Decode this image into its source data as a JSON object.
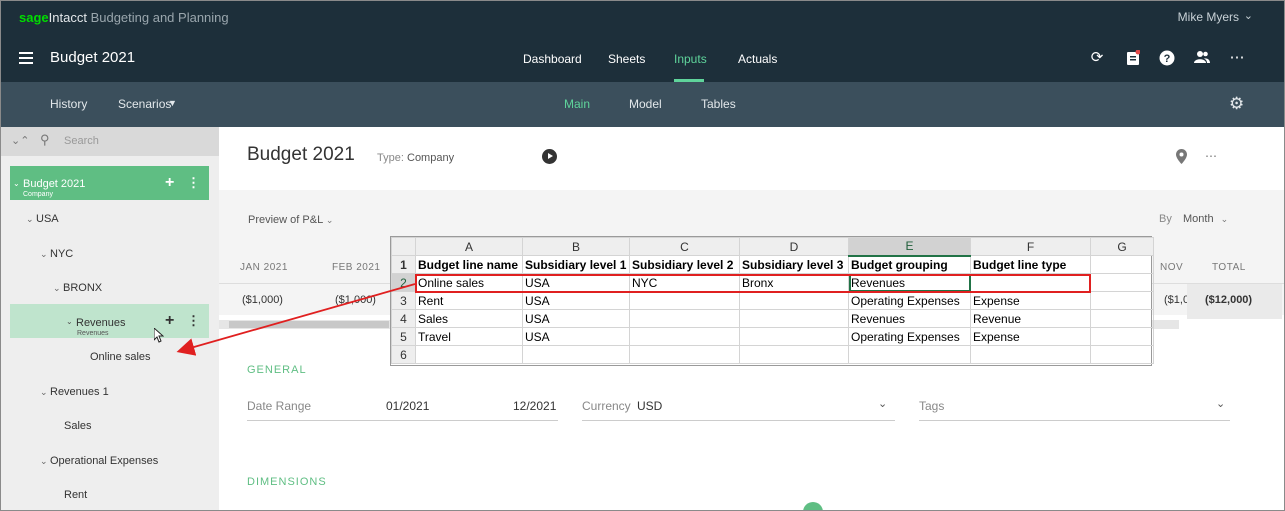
{
  "app": {
    "brand_sage": "sage",
    "brand_intacct": "Intacct",
    "brand_product": "Budgeting and Planning",
    "user_name": "Mike Myers",
    "title": "Budget 2021"
  },
  "main_nav": [
    "Dashboard",
    "Sheets",
    "Inputs",
    "Actuals"
  ],
  "main_nav_active": "Inputs",
  "sub_nav": {
    "left": [
      "History",
      "Scenarios"
    ],
    "center": [
      "Main",
      "Model",
      "Tables"
    ],
    "active": "Main"
  },
  "sidebar": {
    "search_placeholder": "Search",
    "root": {
      "label": "Budget 2021",
      "sublabel": "Company"
    },
    "nodes": [
      {
        "label": "USA"
      },
      {
        "label": "NYC"
      },
      {
        "label": "BRONX"
      },
      {
        "label": "Revenues",
        "sublabel": "Revenues"
      },
      {
        "label": "Online sales"
      },
      {
        "label": "Revenues 1"
      },
      {
        "label": "Sales"
      },
      {
        "label": "Operational Expenses"
      },
      {
        "label": "Rent"
      }
    ]
  },
  "page": {
    "title": "Budget 2021",
    "type_label": "Type:",
    "type_value": "Company",
    "preview": "Preview of P&L",
    "by_label": "By",
    "by_value": "Month",
    "months": [
      "JAN 2021",
      "FEB 2021",
      "NOV",
      "TOTAL"
    ],
    "values": [
      "($1,000)",
      "($1,000)",
      "($1,0",
      "($12,000)"
    ]
  },
  "general": {
    "section": "GENERAL",
    "date_range_label": "Date Range",
    "date_from": "01/2021",
    "date_to": "12/2021",
    "currency_label": "Currency",
    "currency_value": "USD",
    "tags_label": "Tags"
  },
  "dimensions": {
    "section": "DIMENSIONS"
  },
  "spreadsheet": {
    "columns": [
      "A",
      "B",
      "C",
      "D",
      "E",
      "F",
      "G"
    ],
    "row_numbers": [
      "1",
      "2",
      "3",
      "4",
      "5",
      "6"
    ],
    "rows": [
      [
        "Budget line name",
        "Subsidiary level 1",
        "Subsidiary  level 2",
        "Subsidiary  level 3",
        "Budget grouping",
        "Budget line type",
        ""
      ],
      [
        "Online sales",
        "USA",
        "NYC",
        "Bronx",
        "Revenues",
        "",
        ""
      ],
      [
        "Rent",
        "USA",
        "",
        "",
        "Operating Expenses",
        "Expense",
        ""
      ],
      [
        "Sales",
        "USA",
        "",
        "",
        "Revenues",
        "Revenue",
        ""
      ],
      [
        "Travel",
        "USA",
        "",
        "",
        "Operating Expenses",
        "Expense",
        ""
      ],
      [
        "",
        "",
        "",
        "",
        "",
        "",
        ""
      ]
    ]
  },
  "colors": {
    "accent": "#5fbe83",
    "topbar": "#1d2f3a",
    "subbar": "#3b4f5c",
    "annotation": "#e02020"
  }
}
